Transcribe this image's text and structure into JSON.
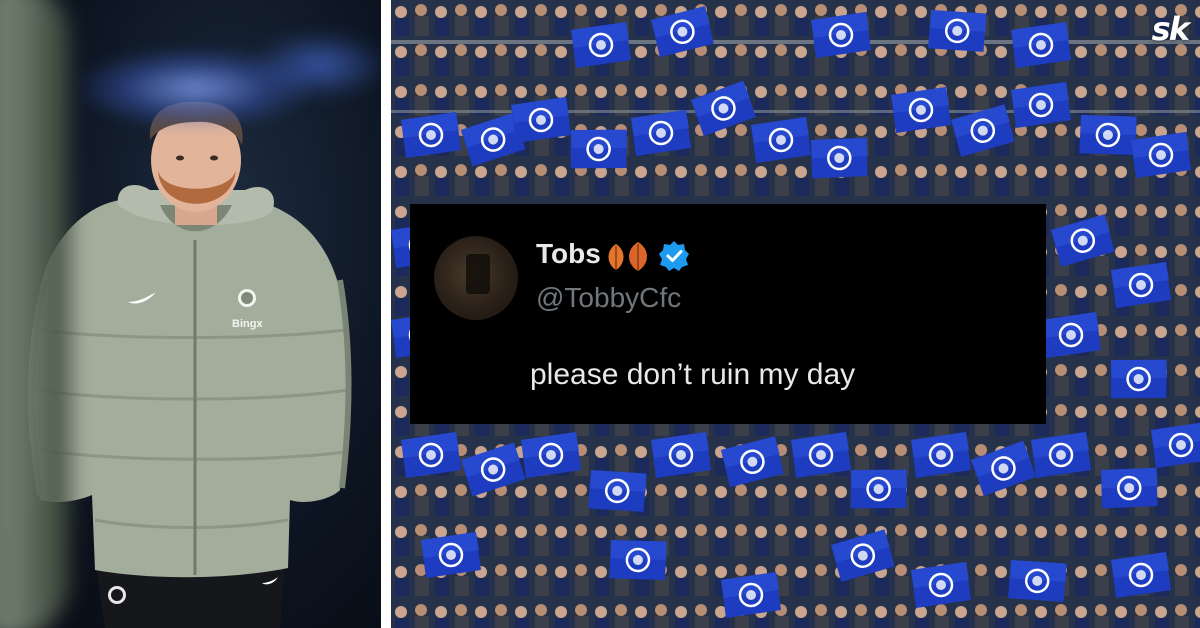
{
  "tweet": {
    "display_name": "Tobs",
    "handle": "@TobbyCfc",
    "text": "please don’t ruin my day",
    "verified": true,
    "name_emoji": "two orange leaves",
    "colors": {
      "background": "#000000",
      "name": "#e7e9ea",
      "handle": "#71767b",
      "verified": "#1d9bf0"
    }
  },
  "left_photo": {
    "jacket_brand": "Bingx"
  },
  "watermark": {
    "text": "sk"
  },
  "colors": {
    "flag_blue": "#1f3fbf",
    "stand_dark": "#0f1a33"
  }
}
